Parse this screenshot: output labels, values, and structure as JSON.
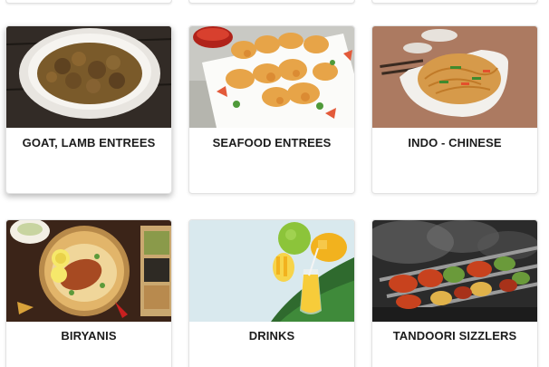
{
  "menu": {
    "categories": [
      {
        "label": "GOAT, LAMB ENTREES",
        "image": "goat-curry-bowl"
      },
      {
        "label": "SEAFOOD ENTREES",
        "image": "fried-shrimp-platter"
      },
      {
        "label": "INDO - CHINESE",
        "image": "hakka-noodles-bowl"
      },
      {
        "label": "BIRYANIS",
        "image": "chicken-biryani-plate"
      },
      {
        "label": "DRINKS",
        "image": "mango-lassi-glass"
      },
      {
        "label": "TANDOORI SIZZLERS",
        "image": "tandoori-skewers-grill"
      }
    ]
  }
}
